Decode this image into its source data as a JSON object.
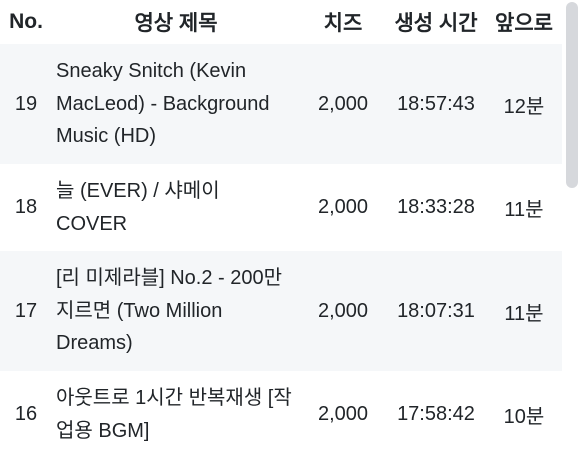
{
  "table": {
    "headers": {
      "no": "No.",
      "title": "영상 제목",
      "cheese": "치즈",
      "created_time": "생성 시간",
      "remaining": "앞으로"
    },
    "rows": [
      {
        "no": "19",
        "title": "Sneaky Snitch (Kevin MacLeod) - Background Music (HD)",
        "cheese": "2,000",
        "created_time": "18:57:43",
        "remaining": "12분"
      },
      {
        "no": "18",
        "title": "늘 (EVER) / 샤메이 COVER",
        "cheese": "2,000",
        "created_time": "18:33:28",
        "remaining": "11분"
      },
      {
        "no": "17",
        "title": "[리 미제라블] No.2 - 200만 지르면 (Two Million Dreams)",
        "cheese": "2,000",
        "created_time": "18:07:31",
        "remaining": "11분"
      },
      {
        "no": "16",
        "title": "아웃트로 1시간 반복재생 [작업용 BGM]",
        "cheese": "2,000",
        "created_time": "17:58:42",
        "remaining": "10분"
      }
    ]
  }
}
